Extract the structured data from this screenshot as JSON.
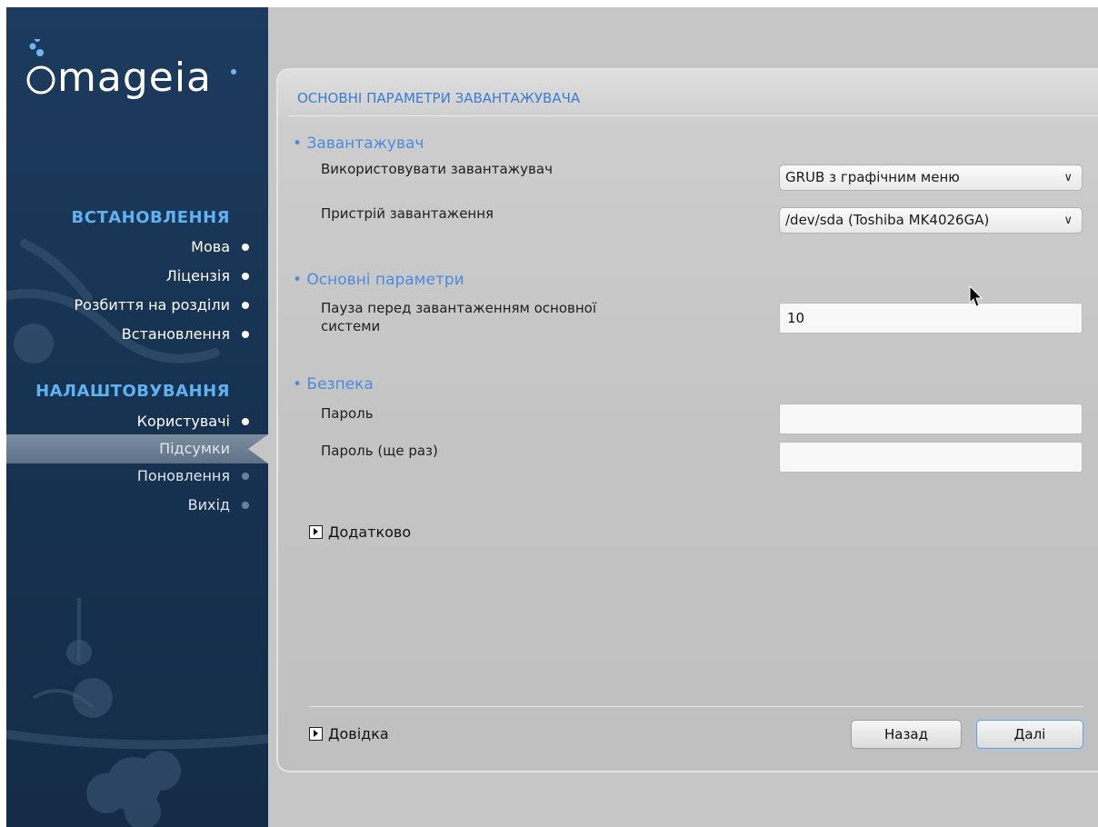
{
  "sidebar": {
    "logo_text": "mageia",
    "install_title": "ВСТАНОВЛЕННЯ",
    "install_steps": [
      {
        "label": "Мова",
        "done": true
      },
      {
        "label": "Ліцензія",
        "done": true
      },
      {
        "label": "Розбиття на розділи",
        "done": true
      },
      {
        "label": "Встановлення",
        "done": true
      }
    ],
    "config_title": "НАЛАШТОВУВАННЯ",
    "config_steps": [
      {
        "label": "Користувачі",
        "done": true
      },
      {
        "label": "Підсумки",
        "done": false,
        "active": true
      },
      {
        "label": "Поновлення",
        "done": false
      },
      {
        "label": "Вихід",
        "done": false
      }
    ]
  },
  "main": {
    "title": "ОСНОВНІ ПАРАМЕТРИ ЗАВАНТАЖУВАЧА",
    "bootloader_section": "• Завантажувач",
    "use_bootloader_label": "Використовувати завантажувач",
    "use_bootloader_value": "GRUB з графічним меню",
    "boot_device_label": "Пристрій завантаження",
    "boot_device_value": "/dev/sda (Toshiba MK4026GA)",
    "main_options_section": "• Основні параметри",
    "delay_label_line1": "Пауза перед завантаженням основної",
    "delay_label_line2": "системи",
    "delay_value": "10",
    "security_section": "• Безпека",
    "password_label": "Пароль",
    "password_value": "",
    "password_again_label": "Пароль (ще раз)",
    "password_again_value": "",
    "advanced_label": "Додатково",
    "help_label": "Довідка",
    "back_button": "Назад",
    "next_button": "Далі"
  },
  "colors": {
    "sidebar_bg": "#173352",
    "sidebar_section_title": "#5fb1f0",
    "section_heading": "#4a8be0",
    "panel_title": "#3c7dd2"
  }
}
